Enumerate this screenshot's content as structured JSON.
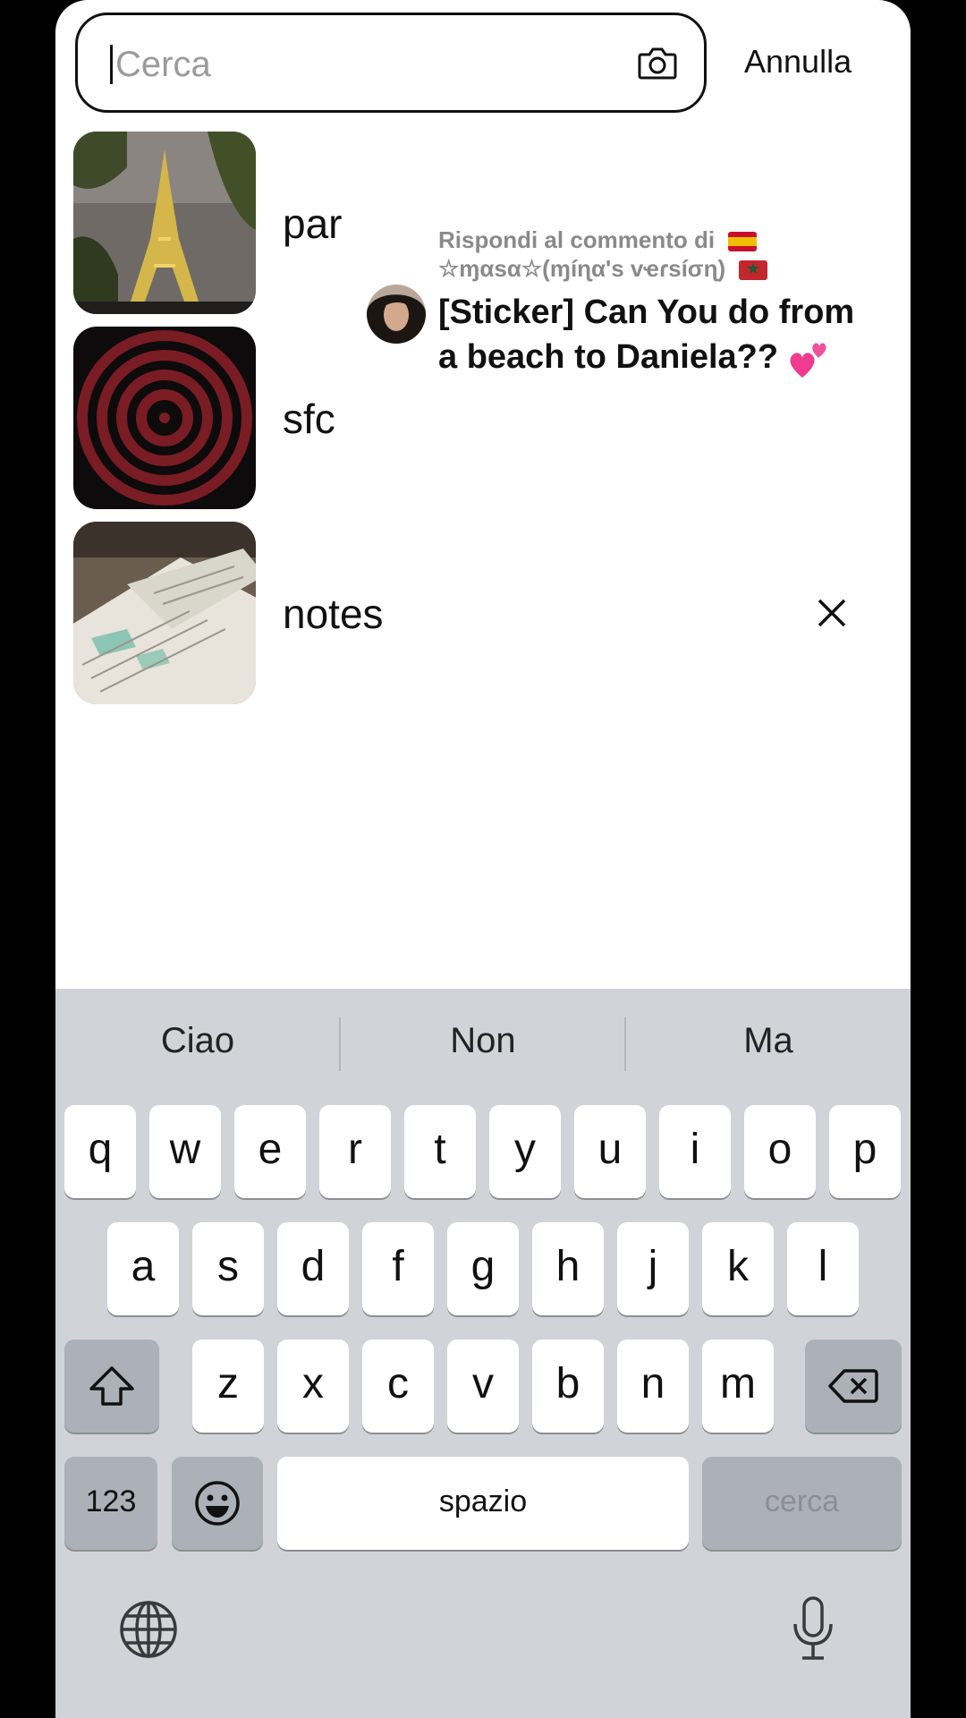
{
  "search": {
    "placeholder": "Cerca",
    "value": "",
    "camera_icon": "camera-icon",
    "cancel_label": "Annulla"
  },
  "history": [
    {
      "label": "par",
      "thumb": "eiffel-tower-photo"
    },
    {
      "label": "sfc",
      "thumb": "red-spiral-image"
    },
    {
      "label": "notes",
      "thumb": "notebook-photo"
    }
  ],
  "reply_overlay": {
    "heading": "Rispondi al commento di",
    "username": "☆ɱαsα☆(ɱíɳα's vҽɾsíσɳ)",
    "text": "[Sticker] Can You do from a beach to Daniela??",
    "flags": [
      "spain-flag",
      "morocco-flag"
    ],
    "emoji": "two-hearts"
  },
  "keyboard": {
    "suggestions": [
      "Ciao",
      "Non",
      "Ma"
    ],
    "row1": [
      "q",
      "w",
      "e",
      "r",
      "t",
      "y",
      "u",
      "i",
      "o",
      "p"
    ],
    "row2": [
      "a",
      "s",
      "d",
      "f",
      "g",
      "h",
      "j",
      "k",
      "l"
    ],
    "row3": [
      "z",
      "x",
      "c",
      "v",
      "b",
      "n",
      "m"
    ],
    "numbers_label": "123",
    "space_label": "spazio",
    "return_label": "cerca"
  },
  "colors": {
    "keyboard_bg": "#d1d3d8",
    "key_bg": "#ffffff",
    "key_dark": "#acb0b8",
    "text": "#111111"
  }
}
